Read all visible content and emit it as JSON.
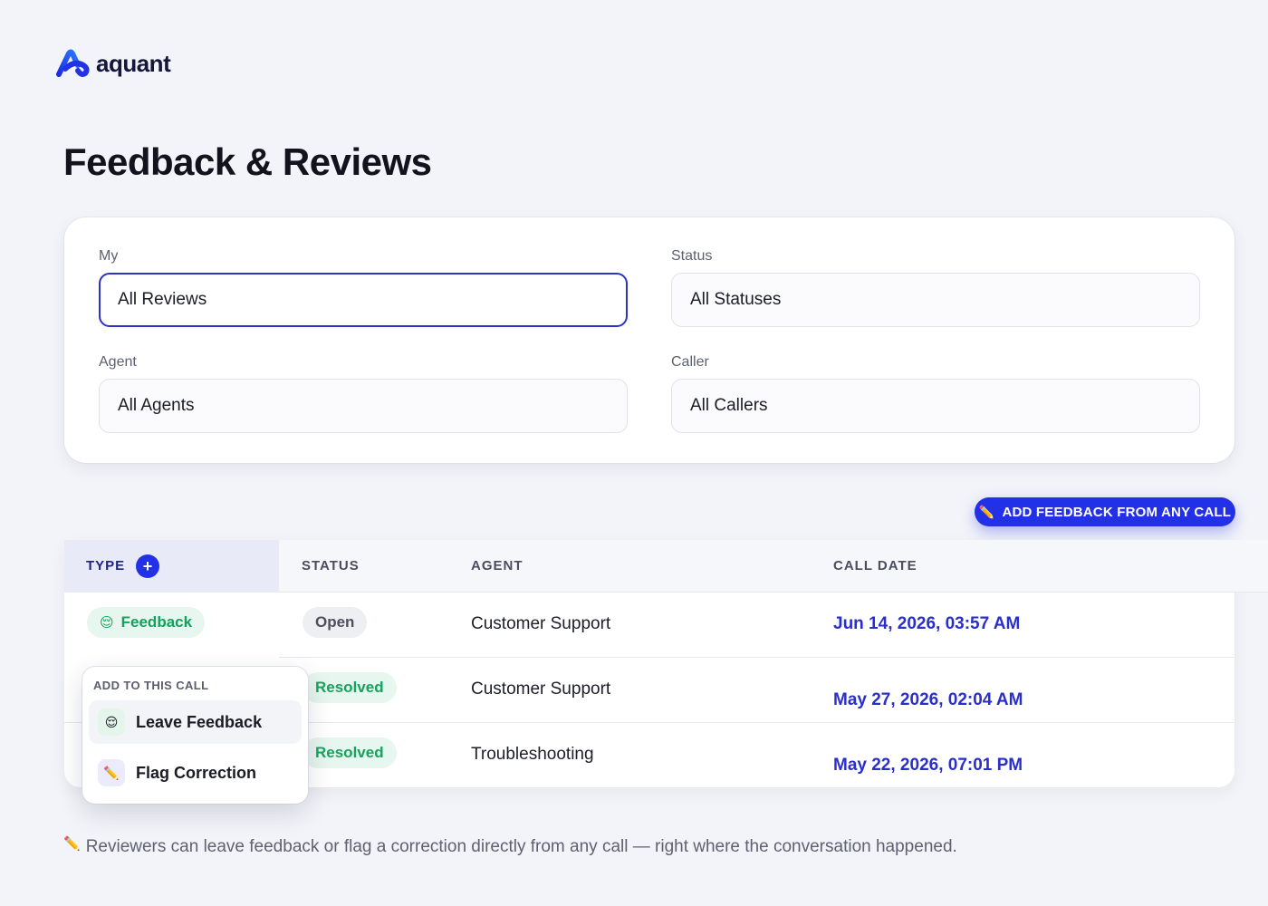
{
  "brand": {
    "name": "aquant",
    "color": "#2231e8"
  },
  "page": {
    "title": "Feedback & Reviews"
  },
  "filters": [
    {
      "label": "My",
      "value": "All Reviews",
      "active": true
    },
    {
      "label": "Status",
      "value": "All Statuses"
    },
    {
      "label": "Agent",
      "value": "All Agents"
    },
    {
      "label": "Caller",
      "value": "All Callers"
    }
  ],
  "actions": {
    "add_feedback_label": "ADD FEEDBACK FROM ANY CALL",
    "add_feedback_icon": "pencil-icon"
  },
  "table": {
    "columns": [
      "TYPE",
      "STATUS",
      "AGENT",
      "CALL DATE"
    ],
    "add_type_symbol": "+",
    "rows": [
      {
        "type": "Feedback",
        "type_icon": "face-icon",
        "status": "Open",
        "agent": "Customer Support",
        "call_date": "Jun 14, 2026, 03:57 AM"
      },
      {
        "type": "",
        "status": "Resolved",
        "agent": "Customer Support",
        "call_date": "May 27, 2026, 02:04 AM"
      },
      {
        "type": "",
        "status": "Resolved",
        "agent": "Troubleshooting",
        "call_date": "May 22, 2026, 07:01 PM"
      }
    ]
  },
  "popup": {
    "title": "ADD TO THIS CALL",
    "items": [
      {
        "label": "Leave Feedback",
        "icon": "face-icon"
      },
      {
        "label": "Flag Correction",
        "icon": "pencil-icon"
      }
    ]
  },
  "footnote": {
    "text": "Reviewers can leave feedback or flag a correction directly from any call — right where the conversation happened."
  },
  "icons": {
    "face": "😌",
    "pencil": "✏️"
  }
}
